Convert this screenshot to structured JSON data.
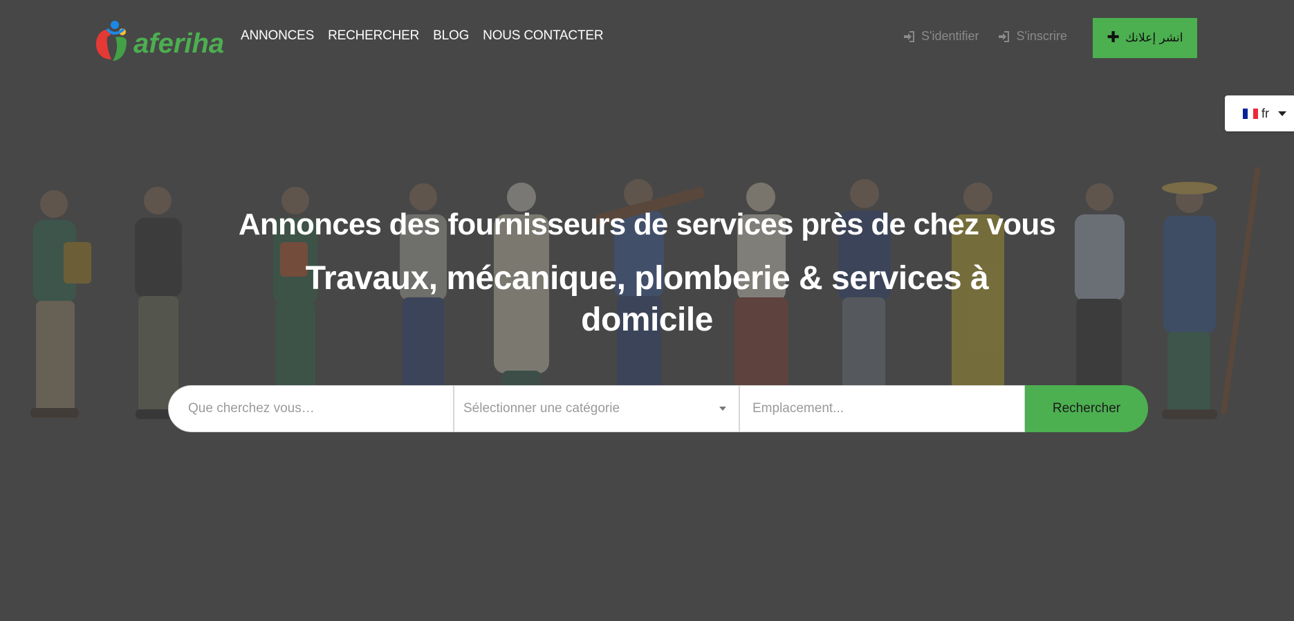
{
  "brand": {
    "name": "aferiha"
  },
  "nav": {
    "items": [
      {
        "label": "ANNONCES"
      },
      {
        "label": "RECHERCHER"
      },
      {
        "label": "BLOG"
      },
      {
        "label": "NOUS CONTACTER"
      }
    ]
  },
  "auth": {
    "login_label": "S'identifier",
    "register_label": "S'inscrire",
    "icon": "sign-in-icon"
  },
  "post_button": {
    "label": "انشر إعلانك",
    "icon": "plus-icon"
  },
  "language": {
    "code": "fr",
    "flag": "france-flag-icon"
  },
  "hero": {
    "title": "Annonces des fournisseurs de services près de chez vous",
    "subtitle": "Travaux, mécanique, plomberie & services à domicile"
  },
  "search": {
    "what_placeholder": "Que cherchez vous…",
    "category_selected": "Sélectionner une catégorie",
    "location_placeholder": "Emplacement...",
    "button_label": "Rechercher"
  },
  "colors": {
    "overlay_background": "#474747",
    "accent_green": "#4caf50",
    "logo_red": "#e53935",
    "logo_blue": "#1e88e5",
    "logo_yellow": "#fbc02d"
  }
}
